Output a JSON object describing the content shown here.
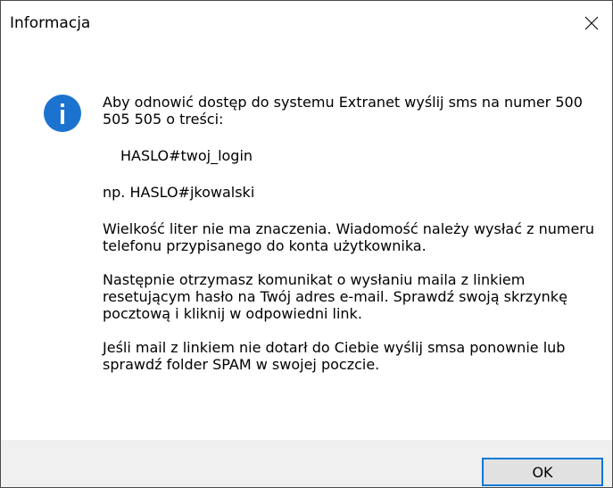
{
  "window": {
    "title": "Informacja",
    "close_icon": "close-icon"
  },
  "message": {
    "icon": "info-icon",
    "icon_color": "#1c73cf",
    "line_intro": "Aby odnowić dostęp do systemu Extranet wyślij sms na numer 500 505 505 o treści:",
    "code": "HASLO#twoj_login",
    "example": "np. HASLO#jkowalski",
    "case_note": "Wielkość liter nie ma znaczenia. Wiadomość należy wysłać z numeru telefonu przypisanego do konta użytkownika.",
    "next_steps": "Następnie otrzymasz komunikat o wysłaniu maila z linkiem resetującym hasło na Twój adres e-mail. Sprawdź swoją skrzynkę pocztową i kliknij w odpowiedni link.",
    "fallback": "Jeśli mail z linkiem nie dotarł do Ciebie wyślij smsa ponownie lub sprawdź folder SPAM w swojej poczcie."
  },
  "footer": {
    "ok_label": "OK",
    "accent": "#0078d7"
  }
}
